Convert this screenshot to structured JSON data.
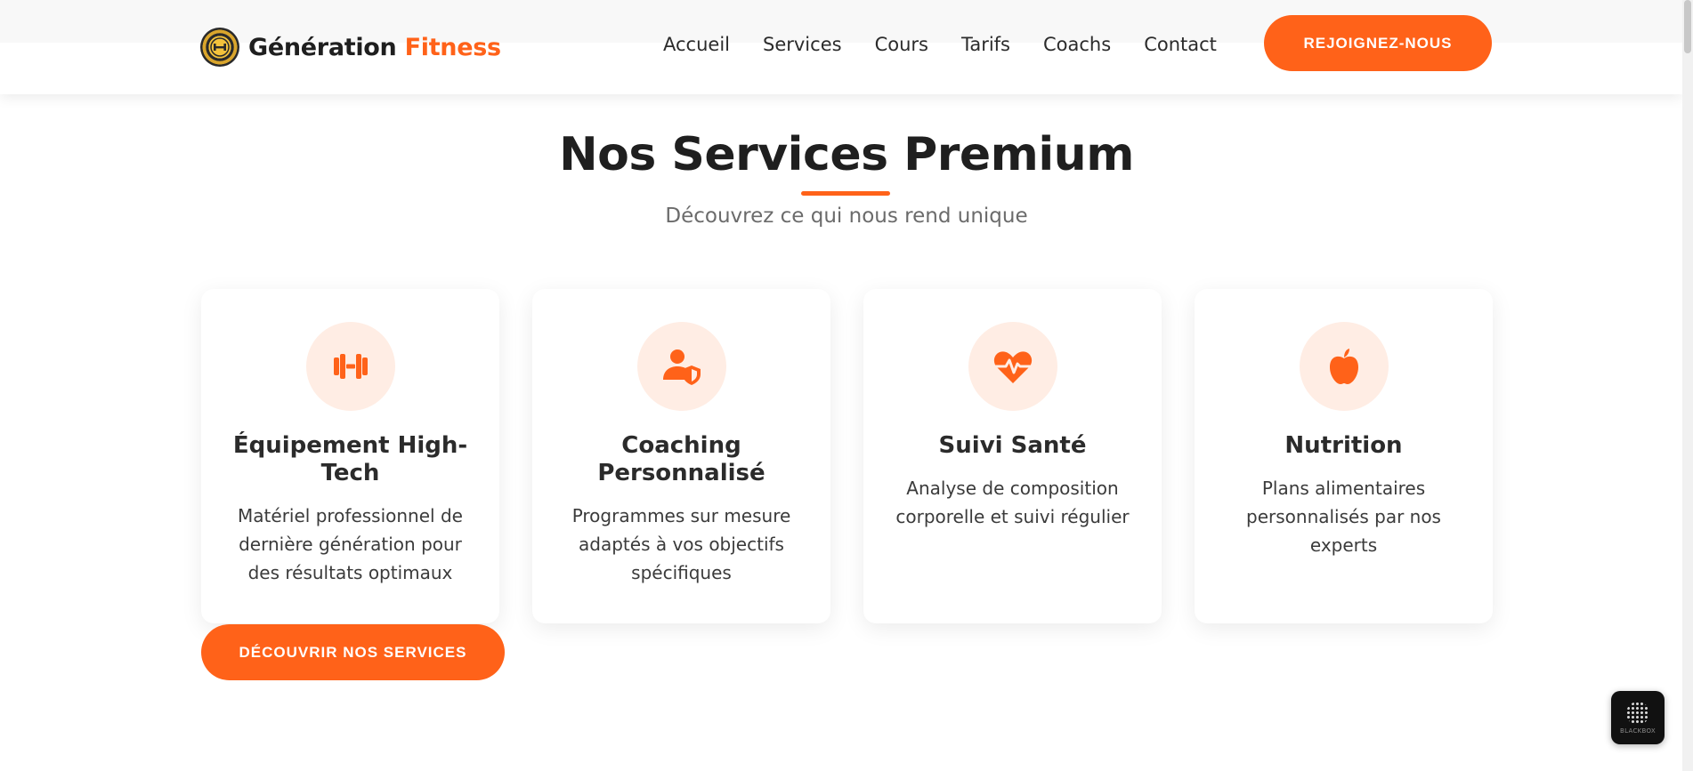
{
  "header": {
    "logo": {
      "brand_main": "Génération",
      "brand_accent": "Fitness",
      "badge_icon": "dumbbell-badge-icon"
    },
    "nav": [
      {
        "label": "Accueil"
      },
      {
        "label": "Services"
      },
      {
        "label": "Cours"
      },
      {
        "label": "Tarifs"
      },
      {
        "label": "Coachs"
      },
      {
        "label": "Contact"
      }
    ],
    "cta_label": "REJOIGNEZ-NOUS"
  },
  "section": {
    "title": "Nos Services Premium",
    "subtitle": "Découvrez ce qui nous rend unique"
  },
  "cards": [
    {
      "icon": "dumbbell-icon",
      "title": "Équipement High-Tech",
      "description": "Matériel professionnel de dernière génération pour des résultats optimaux"
    },
    {
      "icon": "user-shield-icon",
      "title": "Coaching Personnalisé",
      "description": "Programmes sur mesure adaptés à vos objectifs spécifiques"
    },
    {
      "icon": "heart-pulse-icon",
      "title": "Suivi Santé",
      "description": "Analyse de composition corporelle et suivi régulier"
    },
    {
      "icon": "apple-icon",
      "title": "Nutrition",
      "description": "Plans alimentaires personnalisés par nos experts"
    }
  ],
  "cta_services_label": "DÉCOUVRIR NOS SERVICES",
  "widget": {
    "label": "BLACKBOX",
    "icon": "blackbox-logo-icon"
  },
  "colors": {
    "accent": "#ff6219",
    "icon_bg": "#ffede4",
    "heading": "#1f1f1f",
    "muted_text": "#6b6b6b"
  }
}
